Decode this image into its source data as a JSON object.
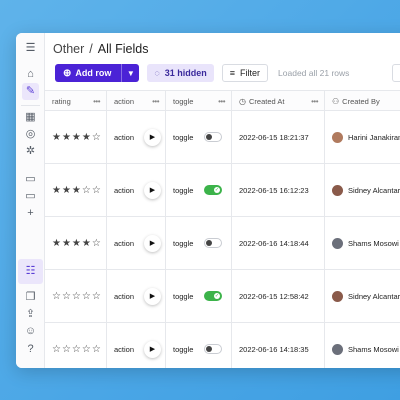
{
  "breadcrumb": {
    "parent": "Other",
    "separator": "/",
    "current": "All Fields"
  },
  "toolbar": {
    "add_row_label": "Add row",
    "hidden_label": "31 hidden",
    "filter_label": "Filter",
    "loaded_text": "Loaded all 21 rows"
  },
  "columns": [
    {
      "label": "rating",
      "icon": ""
    },
    {
      "label": "action",
      "icon": ""
    },
    {
      "label": "toggle",
      "icon": ""
    },
    {
      "label": "Created At",
      "icon": "clock-icon"
    },
    {
      "label": "Created By",
      "icon": "user-icon"
    }
  ],
  "rows": [
    {
      "rating": 4,
      "action": "action",
      "toggle_label": "toggle",
      "toggle_on": false,
      "created_at": "2022-06-15 18:21:37",
      "created_by": "Harini Janakiraman",
      "avatar_color": "#b07a5e"
    },
    {
      "rating": 3,
      "action": "action",
      "toggle_label": "toggle",
      "toggle_on": true,
      "created_at": "2022-06-15 16:12:23",
      "created_by": "Sidney Alcantara",
      "avatar_color": "#8a5a4a"
    },
    {
      "rating": 4,
      "action": "action",
      "toggle_label": "toggle",
      "toggle_on": false,
      "created_at": "2022-06-16 14:18:44",
      "created_by": "Shams Mosowi",
      "avatar_color": "#6b6f7a"
    },
    {
      "rating": 0,
      "action": "action",
      "toggle_label": "toggle",
      "toggle_on": true,
      "created_at": "2022-06-15 12:58:42",
      "created_by": "Sidney Alcantara",
      "avatar_color": "#8a5a4a"
    },
    {
      "rating": 0,
      "action": "action",
      "toggle_label": "toggle",
      "toggle_on": false,
      "created_at": "2022-06-16 14:18:35",
      "created_by": "Shams Mosowi",
      "avatar_color": "#6b6f7a"
    }
  ],
  "colors": {
    "accent": "#4b23d6",
    "accent_soft": "#e9e4fb",
    "toggle_on": "#3cb34a",
    "background": "#4aa6e6"
  }
}
